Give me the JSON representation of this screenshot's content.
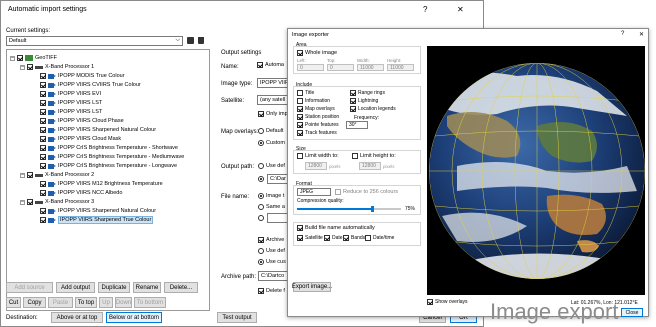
{
  "main": {
    "title": "Automatic import settings",
    "help": "?",
    "close": "✕",
    "current_settings_label": "Current settings:",
    "current_settings_value": "Default",
    "tree": {
      "root": "GeoTIFF",
      "groups": [
        {
          "name": "X-Band Processor 1",
          "items": [
            "IPOPP MODIS True Colour",
            "IPOPP VIIRS CVIIRS True Colour",
            "IPOPP VIIRS EVI",
            "IPOPP VIIRS LST",
            "IPOPP VIIRS LST",
            "IPOPP VIIRS Cloud Phase",
            "IPOPP VIIRS Sharpened Natural Colour",
            "IPOPP VIIRS Cloud Mask",
            "IPOPP CrIS Brightness Temperature - Shortwave",
            "IPOPP CrIS Brightness Temperature - Mediumwave",
            "IPOPP CrIS Brightness Temperature - Longwave"
          ]
        },
        {
          "name": "X-Band Processor 2",
          "items": [
            "IPOPP VIIRS M12 Brightness Temperature",
            "IPOPP VIIRS NCC Albedo"
          ]
        },
        {
          "name": "X-Band Processor 3",
          "items": [
            "IPOPP VIIRS Sharpened Natural Colour",
            "IPOPP VIIRS Sharpened True Colour"
          ]
        }
      ]
    },
    "tree_buttons_row1": [
      "Add source",
      "Add output",
      "Duplicate",
      "Rename",
      "Delete..."
    ],
    "tree_buttons_row2": [
      "Cut",
      "Copy",
      "Paste",
      "To top",
      "Up",
      "Down",
      "To bottom"
    ],
    "destination_label": "Destination:",
    "destination_opts": [
      "Above or at top",
      "Below or at bottom"
    ],
    "output_settings_label": "Output settings",
    "name_label": "Name:",
    "name_value": "Automa",
    "image_type_label": "Image type:",
    "image_type_value": "IPOPP VIIRS",
    "satellite_label": "Satellite:",
    "satellite_value": "(any satell",
    "only_imp": "Only imp",
    "map_overlays_label": "Map overlays:",
    "map_overlays_opts": [
      "Default",
      "Custom"
    ],
    "output_path_label": "Output path:",
    "output_path_opts": [
      "Use def",
      ""
    ],
    "output_path_value": "C:\\Dar",
    "file_name_label": "File name:",
    "file_name_opts": [
      "Image t",
      "Same a",
      ""
    ],
    "archive_label": "Archive",
    "archive_opts": [
      "Use def",
      "Use cus"
    ],
    "archive_path_label": "Archive path:",
    "archive_path_value": "C:\\Dartco",
    "delete_label": "Delete f",
    "test_output": "Test output",
    "cancel": "Cancel",
    "ok": "OK"
  },
  "exporter": {
    "title": "Image exporter",
    "help": "?",
    "close": "✕",
    "area_label": "Area",
    "whole_image": "Whole image",
    "area_fields": [
      {
        "label": "Left:",
        "value": "0"
      },
      {
        "label": "Top:",
        "value": "0"
      },
      {
        "label": "Width:",
        "value": "11000"
      },
      {
        "label": "Height:",
        "value": "11000"
      }
    ],
    "include_label": "Include",
    "include_left": [
      "Title",
      "Information",
      "Map overlays",
      "Station position",
      "Pointe features",
      "Track features"
    ],
    "include_left_on": [
      false,
      false,
      true,
      true,
      true,
      true
    ],
    "include_right": [
      "Range rings",
      "Lightning",
      "Location legends"
    ],
    "include_right_on": [
      true,
      true,
      true
    ],
    "frequency_label": "Frequency:",
    "frequency_value": "30°",
    "size_label": "Size",
    "limit_width": "Limit width to:",
    "limit_width_value": "12800",
    "limit_height": "Limit height to:",
    "limit_height_value": "12800",
    "pixels": "pixels",
    "format_label": "Format",
    "format_value": "JPEG",
    "reduce": "Reduce to 256 colours",
    "compression_label": "Compression quality:",
    "compression_value": "75%",
    "compression_level": 0.72,
    "build_name": "Build file name automatically",
    "name_parts": [
      "Satellite",
      "Date",
      "Bands",
      "Date/time"
    ],
    "name_parts_on": [
      true,
      true,
      true,
      false
    ],
    "export_image": "Export image...",
    "show_overlays": "Show overlays",
    "coords": "Lat: 01.267%, Lon: 121.012°E",
    "close_btn": "Close"
  },
  "caption": "Image export",
  "colors": {
    "accent": "#0078d7",
    "caption": "#8c8c8c",
    "grid": "#e6d23a"
  }
}
